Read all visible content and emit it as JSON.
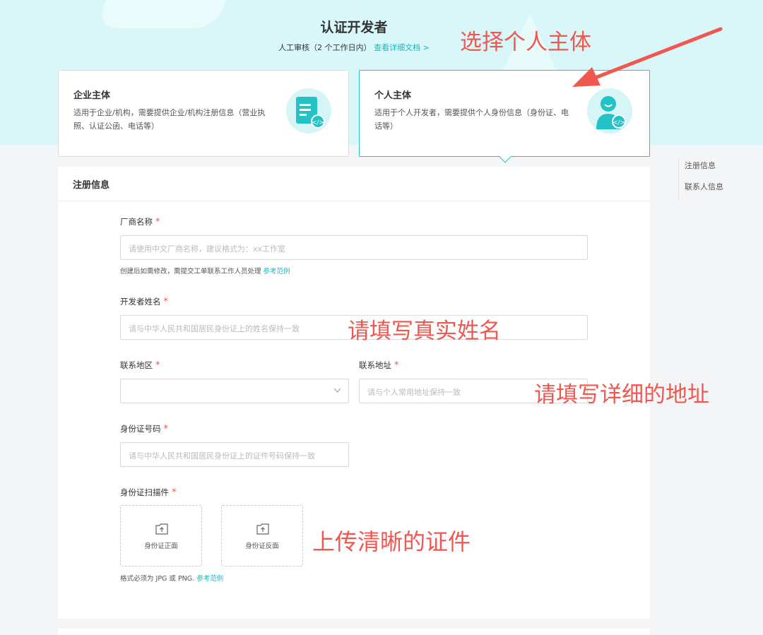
{
  "header": {
    "title": "认证开发者",
    "subtitle": "人工审核（2 个工作日内）",
    "doc_link": "查看详细文档 >"
  },
  "cards": {
    "enterprise": {
      "title": "企业主体",
      "desc": "适用于企业/机构，需要提供企业/机构注册信息（营业执照、认证公函、电话等）"
    },
    "personal": {
      "title": "个人主体",
      "desc": "适用于个人开发者，需要提供个人身份信息（身份证、电话等）"
    }
  },
  "form": {
    "section_title": "注册信息",
    "vendor_name": {
      "label": "厂商名称",
      "placeholder": "请使用中文厂商名称，建议格式为：xx工作室",
      "hint": "创建后如需修改，需提交工单联系工作人员处理",
      "hint_link": "参考范例"
    },
    "developer_name": {
      "label": "开发者姓名",
      "placeholder": "请与中华人民共和国居民身份证上的姓名保持一致"
    },
    "region": {
      "label": "联系地区",
      "value": ""
    },
    "address": {
      "label": "联系地址",
      "placeholder": "请与个人常用地址保持一致"
    },
    "id_number": {
      "label": "身份证号码",
      "placeholder": "请与中华人民共和国居民身份证上的证件号码保持一致"
    },
    "id_scan": {
      "label": "身份证扫描件",
      "front": "身份证正面",
      "back": "身份证反面",
      "hint": "格式必须为 JPG 或 PNG.",
      "hint_link": "参考范例"
    },
    "required_mark": "*"
  },
  "side_nav": [
    "注册信息",
    "联系人信息"
  ],
  "annotations": {
    "choose_personal": "选择个人主体",
    "real_name": "请填写真实姓名",
    "detail_address": "请填写详细的地址",
    "clear_id": "上传清晰的证件"
  },
  "colors": {
    "accent": "#1fb6ba",
    "required": "#f05454",
    "annotation": "#f0574f",
    "hero_bg": "#d9f7f8"
  },
  "icons": [
    "document-code-icon",
    "person-code-icon",
    "chevron-down-icon",
    "upload-icon",
    "arrow-annotation"
  ]
}
